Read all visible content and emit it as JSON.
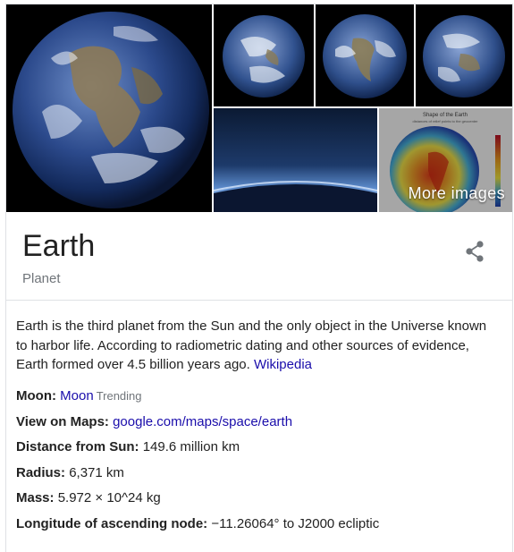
{
  "images": {
    "main_alt": "Earth full disk",
    "thumb2_alt": "Earth blue marble",
    "thumb3_alt": "Earth blue marble Americas",
    "thumb4_alt": "Earth blue marble",
    "thumb5_alt": "Earth horizon from orbit",
    "thumb6_alt": "Shape of the Earth chart",
    "thumb6_caption_title": "Shape of the Earth",
    "thumb6_caption_sub": "distances of relief points to the geocenter",
    "more_images_label": "More images"
  },
  "entity": {
    "title": "Earth",
    "subtitle": "Planet"
  },
  "icons": {
    "share": "share-icon"
  },
  "description": {
    "text": "Earth is the third planet from the Sun and the only object in the Universe known to harbor life. According to radiometric dating and other sources of evidence, Earth formed over 4.5 billion years ago.",
    "source_link": "Wikipedia"
  },
  "facts": {
    "moon": {
      "label": "Moon:",
      "value": "Moon",
      "badge": "Trending"
    },
    "maps": {
      "label": "View on Maps:",
      "value": "google.com/maps/space/earth"
    },
    "distance": {
      "label": "Distance from Sun:",
      "value": "149.6 million km"
    },
    "radius": {
      "label": "Radius:",
      "value": "6,371 km"
    },
    "mass": {
      "label": "Mass:",
      "value": "5.972 × 10^24 kg"
    },
    "longitude": {
      "label": "Longitude of ascending node:",
      "value": "−11.26064° to J2000 ecliptic"
    }
  },
  "colors": {
    "link": "#1a0dab",
    "text": "#222222",
    "muted": "#70757a",
    "border": "#dfe1e5"
  }
}
